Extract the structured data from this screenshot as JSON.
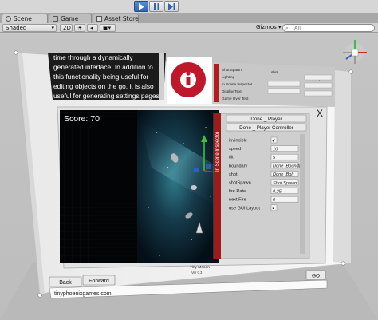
{
  "tabs": [
    {
      "label": "Scene",
      "active": true
    },
    {
      "label": "Game",
      "active": false
    },
    {
      "label": "Asset Store",
      "active": false
    }
  ],
  "toolbar": {
    "shading_mode": "Shaded",
    "view_2d": "2D",
    "gizmos": "Gizmos",
    "search_placeholder": "All"
  },
  "play_controls": {
    "play_icon": "play-icon",
    "pause_icon": "pause-icon",
    "step_icon": "step-icon"
  },
  "article_lines": [
    "time through a dynamically",
    "generated interface. In addition to",
    "this functionality being useful for",
    "editing objects on the go, it is also",
    "useful for generating settings pages"
  ],
  "mini_panel": [
    "Shot Spawn",
    "Lighting",
    "In Scene Inspector",
    "Display Text",
    "Game Over Text"
  ],
  "mini_panel_right": [
    "shot",
    "Shot Spawn",
    "0.25",
    "0.5"
  ],
  "game": {
    "score_label": "Score: 70",
    "credit_line1": "Tiny Mooon",
    "credit_line2": "Ver 0.3"
  },
  "inspector": {
    "side_label": "In Scene Inspector",
    "close_label": "X",
    "buttons": [
      "Done _ Player",
      "Done _ Player Controller"
    ],
    "fields": [
      {
        "label": "invincible",
        "value": "✔"
      },
      {
        "label": "speed",
        "value": "10"
      },
      {
        "label": "tilt",
        "value": "5"
      },
      {
        "label": "boundary",
        "value": "Done_Boundary"
      },
      {
        "label": "shot",
        "value": "Done_Bolt"
      },
      {
        "label": "shotSpawn",
        "value": "Shot Spawn"
      },
      {
        "label": "fire Rate",
        "value": "0.25"
      },
      {
        "label": "next Fire",
        "value": "0"
      },
      {
        "label": "use GUI Layout",
        "value": "✔"
      }
    ]
  },
  "browser": {
    "back_label": "Back",
    "forward_label": "Forward",
    "go_label": "GO",
    "url": "tinyphoenixgames.com"
  },
  "colors": {
    "accent": "#2e64b5",
    "logo_red": "#c0182b",
    "score_text": "#ffffff"
  }
}
